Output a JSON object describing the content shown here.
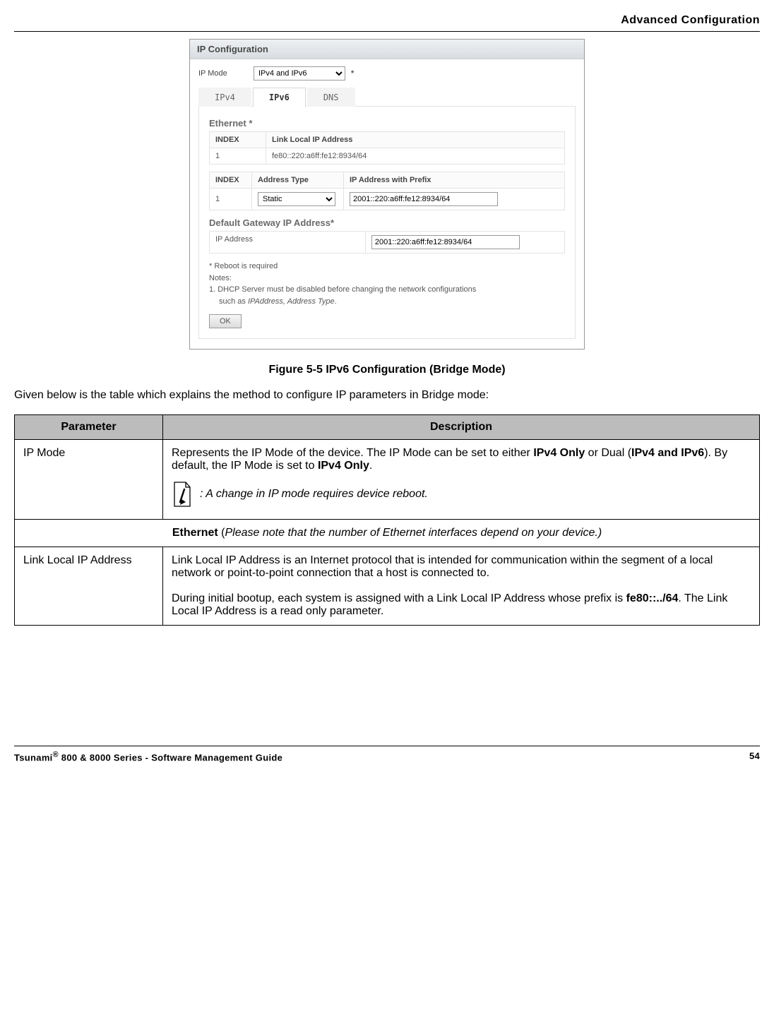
{
  "header": {
    "title": "Advanced Configuration"
  },
  "shot": {
    "panel_title": "IP Configuration",
    "ip_mode_label": "IP Mode",
    "ip_mode_value": "IPv4 and IPv6",
    "star": "*",
    "tabs": {
      "ipv4": "IPv4",
      "ipv6": "IPv6",
      "dns": "DNS"
    },
    "ethernet_heading": "Ethernet *",
    "link_table": {
      "h_index": "INDEX",
      "h_addr": "Link Local IP Address",
      "r1_index": "1",
      "r1_addr": "fe80::220:a6ff:fe12:8934/64"
    },
    "prefix_table": {
      "h_index": "INDEX",
      "h_type": "Address Type",
      "h_addr": "IP Address with Prefix",
      "r1_index": "1",
      "r1_type": "Static",
      "r1_addr": "2001::220:a6ff:fe12:8934/64"
    },
    "gw_heading": "Default Gateway IP Address*",
    "gw_label": "IP Address",
    "gw_value": "2001::220:a6ff:fe12:8934/64",
    "notes_star_line": "* Reboot is required",
    "notes_heading": "Notes:",
    "notes_line1a": "1. DHCP Server must be disabled before changing the network configurations",
    "notes_line1b_prefix": "such as ",
    "notes_line1b_italic": "IPAddress, Address Type",
    "notes_line1b_suffix": ".",
    "ok": "OK"
  },
  "caption": "Figure 5-5 IPv6 Configuration (Bridge Mode)",
  "intro": "Given below is the table which explains the method to configure IP parameters in Bridge mode:",
  "doc_table": {
    "h_param": "Parameter",
    "h_desc": "Description",
    "r1_param": "IP Mode",
    "r1_desc_1": "Represents the IP Mode of the device. The IP Mode can be set to either ",
    "r1_desc_2": "IPv4 Only",
    "r1_desc_3": " or Dual (",
    "r1_desc_4": "IPv4 and IPv6",
    "r1_desc_5": "). By default, the IP Mode is set to ",
    "r1_desc_6": "IPv4 Only",
    "r1_desc_7": ".",
    "r1_note": ": A change in IP mode requires device reboot.",
    "r2_span_1": "Ethernet",
    "r2_span_2": " (",
    "r2_span_3": "Please note that the number of Ethernet interfaces depend on your device.)",
    "r3_param": "Link Local IP Address",
    "r3_p1": "Link Local IP Address is an Internet protocol that is intended for communication within the segment of a local network or point-to-point connection that a host is connected to.",
    "r3_p2a": "During initial bootup, each system is assigned with a Link Local IP Address whose prefix is ",
    "r3_p2b": "fe80::../64",
    "r3_p2c": ". The Link Local IP Address is a read only parameter."
  },
  "footer": {
    "left_a": "Tsunami",
    "left_b": "®",
    "left_c": " 800 & 8000 Series - Software Management Guide",
    "page": "54"
  }
}
